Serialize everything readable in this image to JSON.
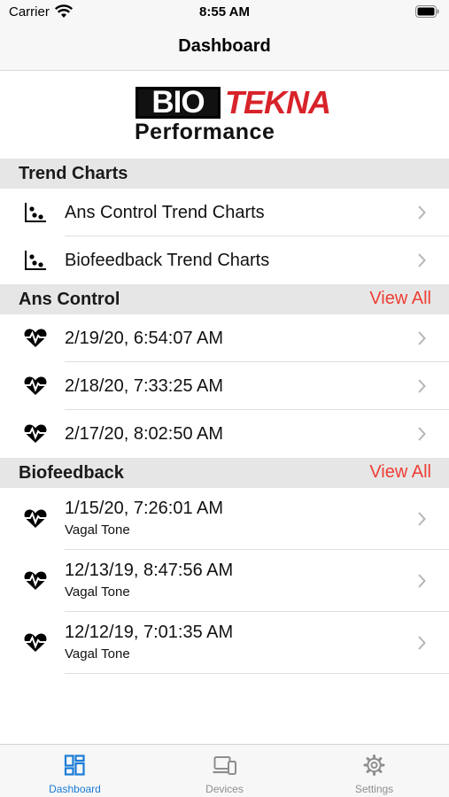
{
  "status_bar": {
    "carrier": "Carrier",
    "time": "8:55 AM"
  },
  "nav": {
    "title": "Dashboard"
  },
  "logo": {
    "bio": "BIO",
    "tekna": "TEKNA",
    "performance": "Performance"
  },
  "trend_charts": {
    "header": "Trend Charts",
    "items": [
      {
        "label": "Ans Control Trend Charts",
        "icon": "scatter-chart-icon"
      },
      {
        "label": "Biofeedback Trend Charts",
        "icon": "scatter-chart-icon"
      }
    ]
  },
  "ans_control": {
    "header": "Ans Control",
    "view_all": "View All",
    "items": [
      {
        "title": "2/19/20, 6:54:07 AM",
        "icon": "heart-pulse-icon"
      },
      {
        "title": "2/18/20, 7:33:25 AM",
        "icon": "heart-pulse-icon"
      },
      {
        "title": "2/17/20, 8:02:50 AM",
        "icon": "heart-pulse-icon"
      }
    ]
  },
  "biofeedback": {
    "header": "Biofeedback",
    "view_all": "View All",
    "items": [
      {
        "title": "1/15/20, 7:26:01 AM",
        "subtitle": "Vagal Tone",
        "icon": "heart-pulse-icon"
      },
      {
        "title": "12/13/19, 8:47:56 AM",
        "subtitle": "Vagal Tone",
        "icon": "heart-pulse-icon"
      },
      {
        "title": "12/12/19, 7:01:35 AM",
        "subtitle": "Vagal Tone",
        "icon": "heart-pulse-icon"
      }
    ]
  },
  "tabs": [
    {
      "label": "Dashboard",
      "icon": "dashboard-grid-icon",
      "active": true
    },
    {
      "label": "Devices",
      "icon": "devices-icon",
      "active": false
    },
    {
      "label": "Settings",
      "icon": "gear-icon",
      "active": false
    }
  ],
  "colors": {
    "accent": "#ef3e35",
    "tab_active": "#1a7ad6",
    "brand_red": "#d8232a"
  }
}
